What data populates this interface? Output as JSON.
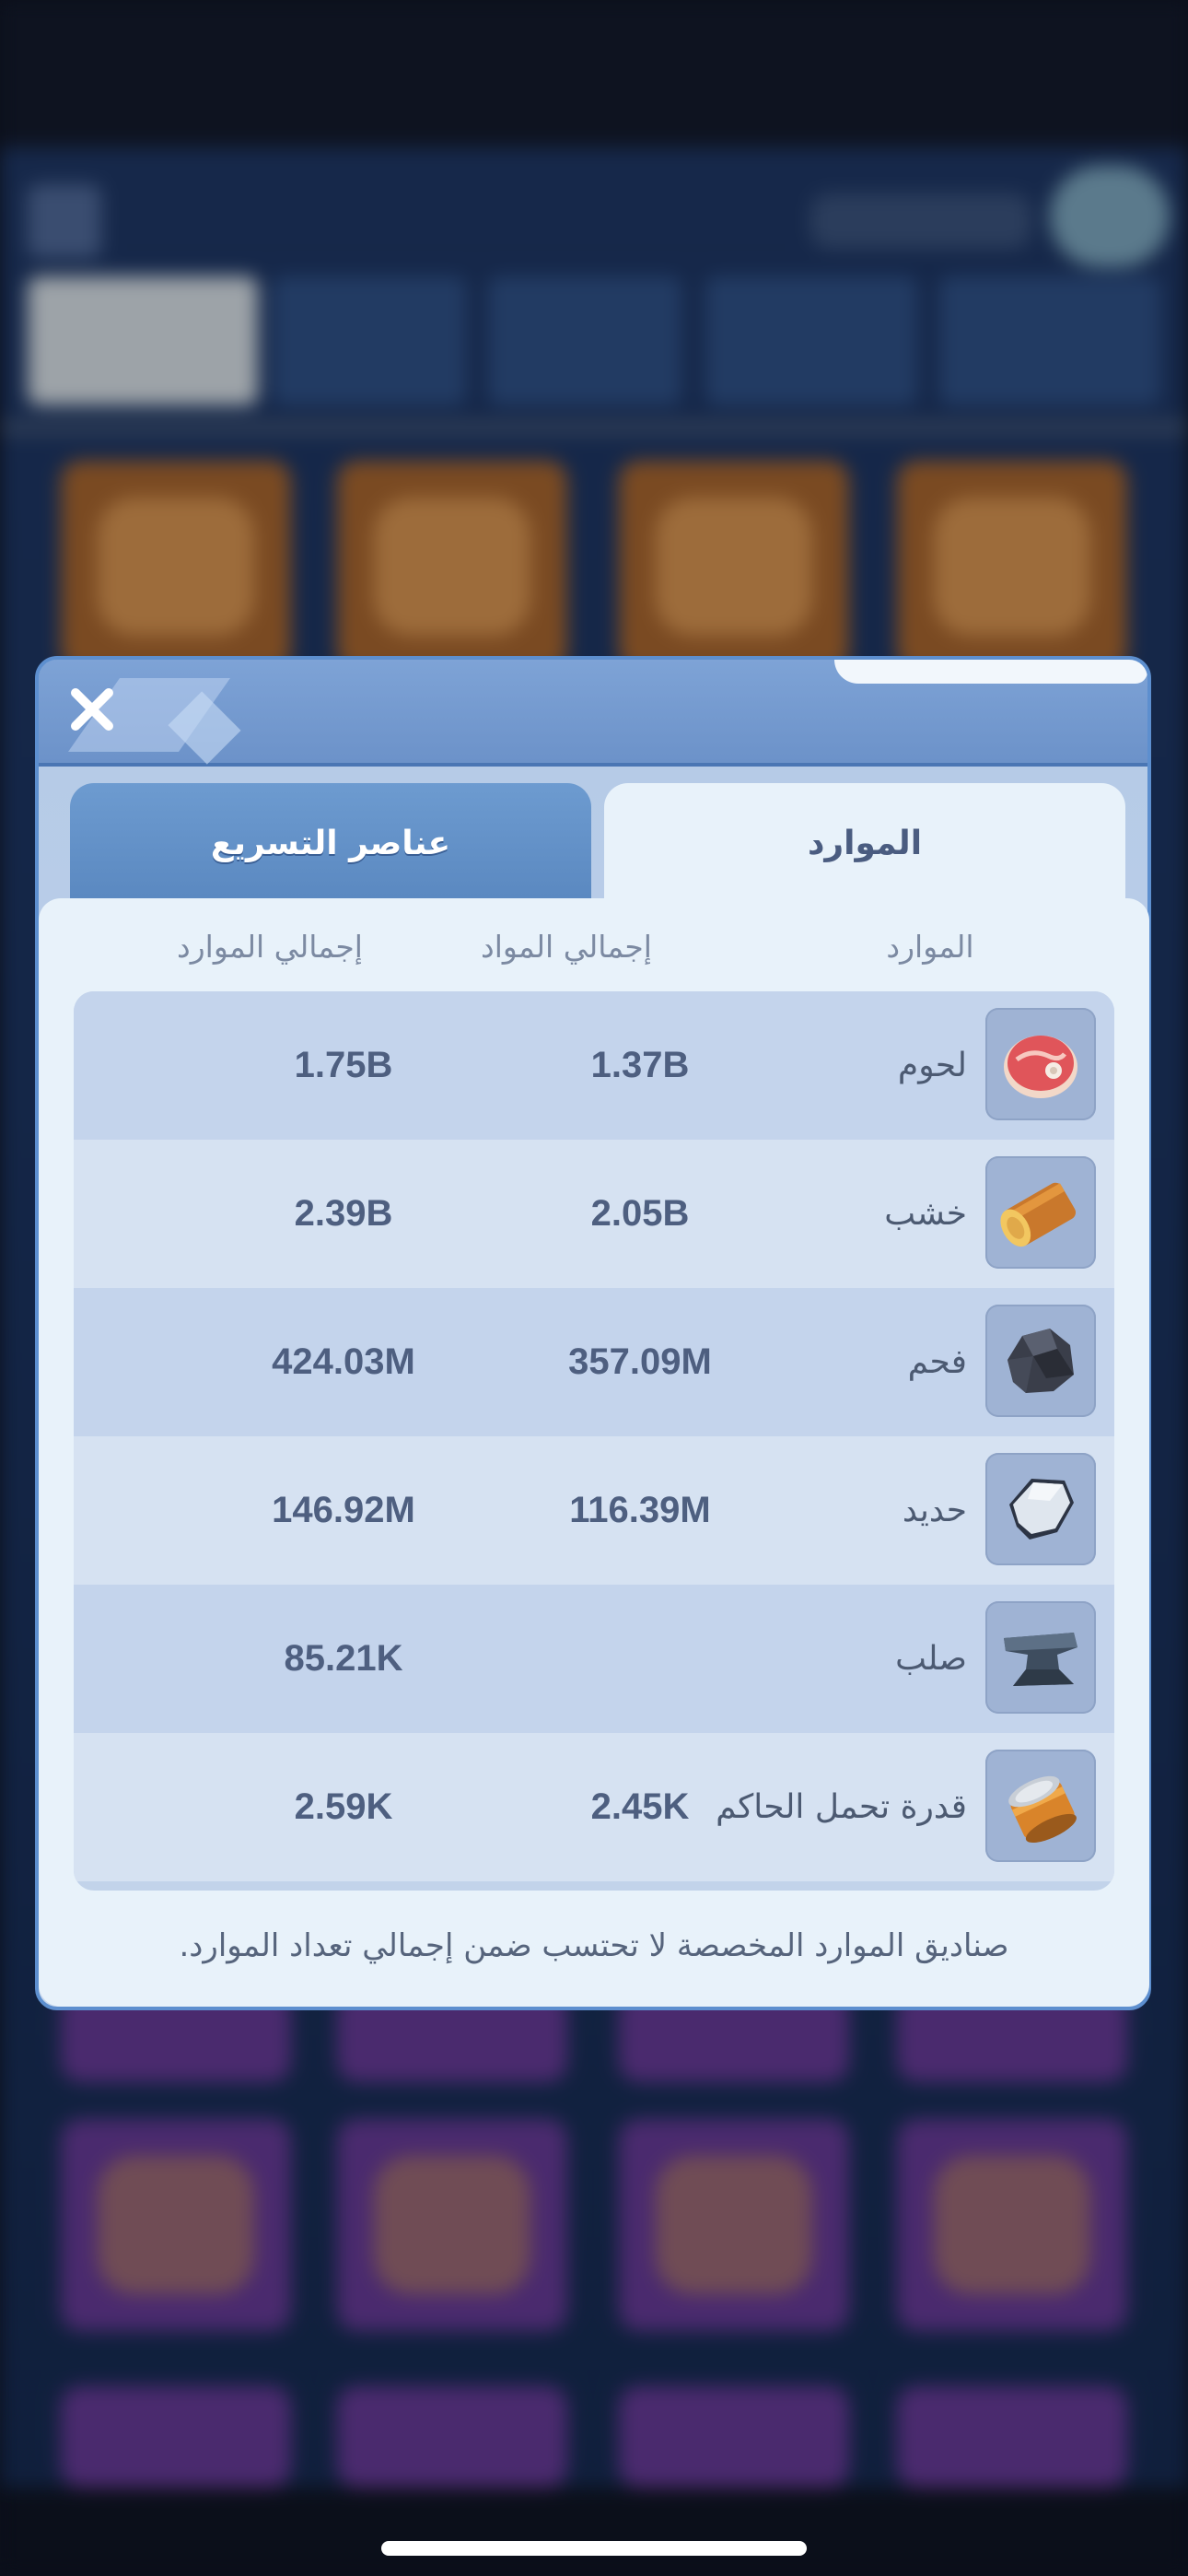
{
  "modal": {
    "tabs": [
      {
        "label": "الموارد",
        "active": true
      },
      {
        "label": "عناصر التسريع",
        "active": false
      }
    ],
    "columns": {
      "resource": "الموارد",
      "materials": "إجمالي المواد",
      "total": "إجمالي الموارد"
    },
    "rows": [
      {
        "name": "لحوم",
        "icon": "meat-icon",
        "materials": "1.37B",
        "total": "1.75B"
      },
      {
        "name": "خشب",
        "icon": "wood-log-icon",
        "materials": "2.05B",
        "total": "2.39B"
      },
      {
        "name": "فحم",
        "icon": "coal-icon",
        "materials": "357.09M",
        "total": "424.03M"
      },
      {
        "name": "حديد",
        "icon": "iron-ore-icon",
        "materials": "116.39M",
        "total": "146.92M"
      },
      {
        "name": "صلب",
        "icon": "steel-anvil-icon",
        "materials": "",
        "total": "85.21K"
      },
      {
        "name": "قدرة تحمل الحاكم",
        "icon": "stamina-can-icon",
        "materials": "2.45K",
        "total": "2.59K"
      }
    ],
    "footnote": "صناديق الموارد المخصصة لا تحتسب ضمن إجمالي تعداد الموارد."
  },
  "colors": {
    "modal_border": "#5d8fcf",
    "active_tab": "#e8f2fa",
    "inactive_tab": "#5a88c0",
    "value_text": "#4e5f80"
  }
}
